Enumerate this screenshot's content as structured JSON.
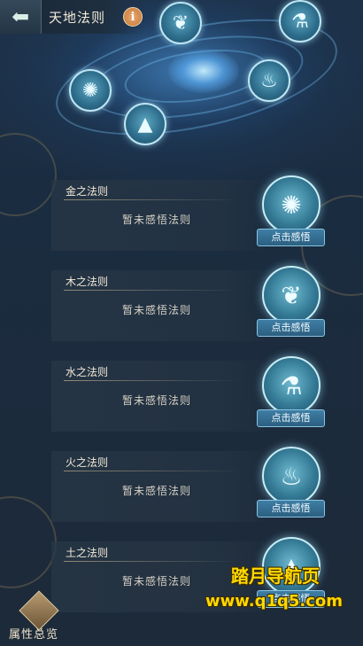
{
  "header": {
    "back_icon": "back-arrow-icon",
    "title": "天地法则",
    "info_icon": "i"
  },
  "galaxy_orbs": [
    {
      "name": "wood-leaf-orb",
      "icon": "leaf-icon",
      "glyph": "❦"
    },
    {
      "name": "water-flask-orb",
      "icon": "flask-icon",
      "glyph": "⚗"
    },
    {
      "name": "metal-swirl-orb",
      "icon": "swirl-icon",
      "glyph": "✺"
    },
    {
      "name": "fire-flame-orb",
      "icon": "flame-icon",
      "glyph": "♨"
    },
    {
      "name": "earth-peak-orb",
      "icon": "mountain-icon",
      "glyph": "▲"
    }
  ],
  "laws": [
    {
      "title": "金之法则",
      "status": "暂未感悟法则",
      "button": "点击感悟",
      "icon": "swirl-icon",
      "glyph": "✺"
    },
    {
      "title": "木之法则",
      "status": "暂未感悟法则",
      "button": "点击感悟",
      "icon": "leaf-icon",
      "glyph": "❦"
    },
    {
      "title": "水之法则",
      "status": "暂未感悟法则",
      "button": "点击感悟",
      "icon": "flask-icon",
      "glyph": "⚗"
    },
    {
      "title": "火之法则",
      "status": "暂未感悟法则",
      "button": "点击感悟",
      "icon": "flame-icon",
      "glyph": "♨"
    },
    {
      "title": "土之法则",
      "status": "暂未感悟法则",
      "button": "点击感悟",
      "icon": "mountain-icon",
      "glyph": "▲"
    }
  ],
  "summary": {
    "label": "属性总览",
    "icon": "attribute-emblem-icon"
  },
  "watermark": {
    "title": "踏月导航页",
    "url": "www.q1q5.com"
  },
  "colors": {
    "accent": "#3f7ea4",
    "title_text": "#f3ead8",
    "info": "#c3783c",
    "watermark": "#ffd800"
  }
}
